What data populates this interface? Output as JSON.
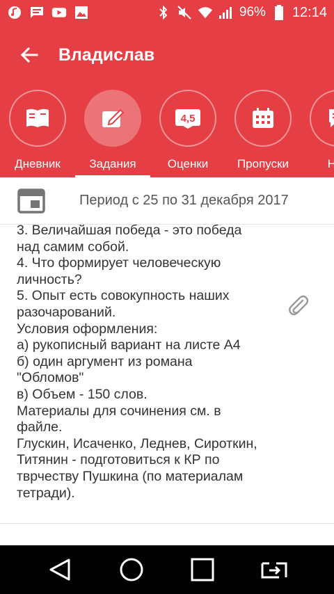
{
  "status_bar": {
    "battery": "96%",
    "time": "12:14",
    "icons": [
      "music-icon",
      "message-icon",
      "youtube-icon",
      "image-icon",
      "bluetooth-icon",
      "mute-icon",
      "wifi-icon",
      "signal-icon",
      "battery-icon"
    ]
  },
  "app_bar": {
    "title": "Владислав"
  },
  "tabs": [
    {
      "label": "Дневник",
      "icon": "book-icon"
    },
    {
      "label": "Задания",
      "icon": "edit-icon",
      "active": true
    },
    {
      "label": "Оценки",
      "icon": "grades-icon",
      "icon_text": "4,5"
    },
    {
      "label": "Пропуски",
      "icon": "calendar-icon"
    },
    {
      "label": "Нов",
      "icon": "news-icon"
    }
  ],
  "period": {
    "text": "Период с 25 по 31 декабря 2017"
  },
  "task": {
    "lines": [
      "3. Величайшая победа - это победа",
      "над самим собой.",
      "4. Что формирует человеческую",
      "личность?",
      "5. Опыт есть совокупность наших",
      "разочарований.",
      "Условия оформления:",
      "а) рукописный вариант на листе А4",
      "б) один аргумент из романа",
      "\"Обломов\"",
      "в) Объем - 150 слов.",
      "Материалы для сочинения см. в",
      "файле.",
      "Глускин, Исаченко, Леднев, Сироткин,",
      "Титянин - подготовиться к КР по",
      "тврчеству Пушкина (по материалам",
      "тетради)."
    ]
  },
  "colors": {
    "accent": "#e53f45",
    "text": "#333333",
    "muted": "#555555"
  }
}
